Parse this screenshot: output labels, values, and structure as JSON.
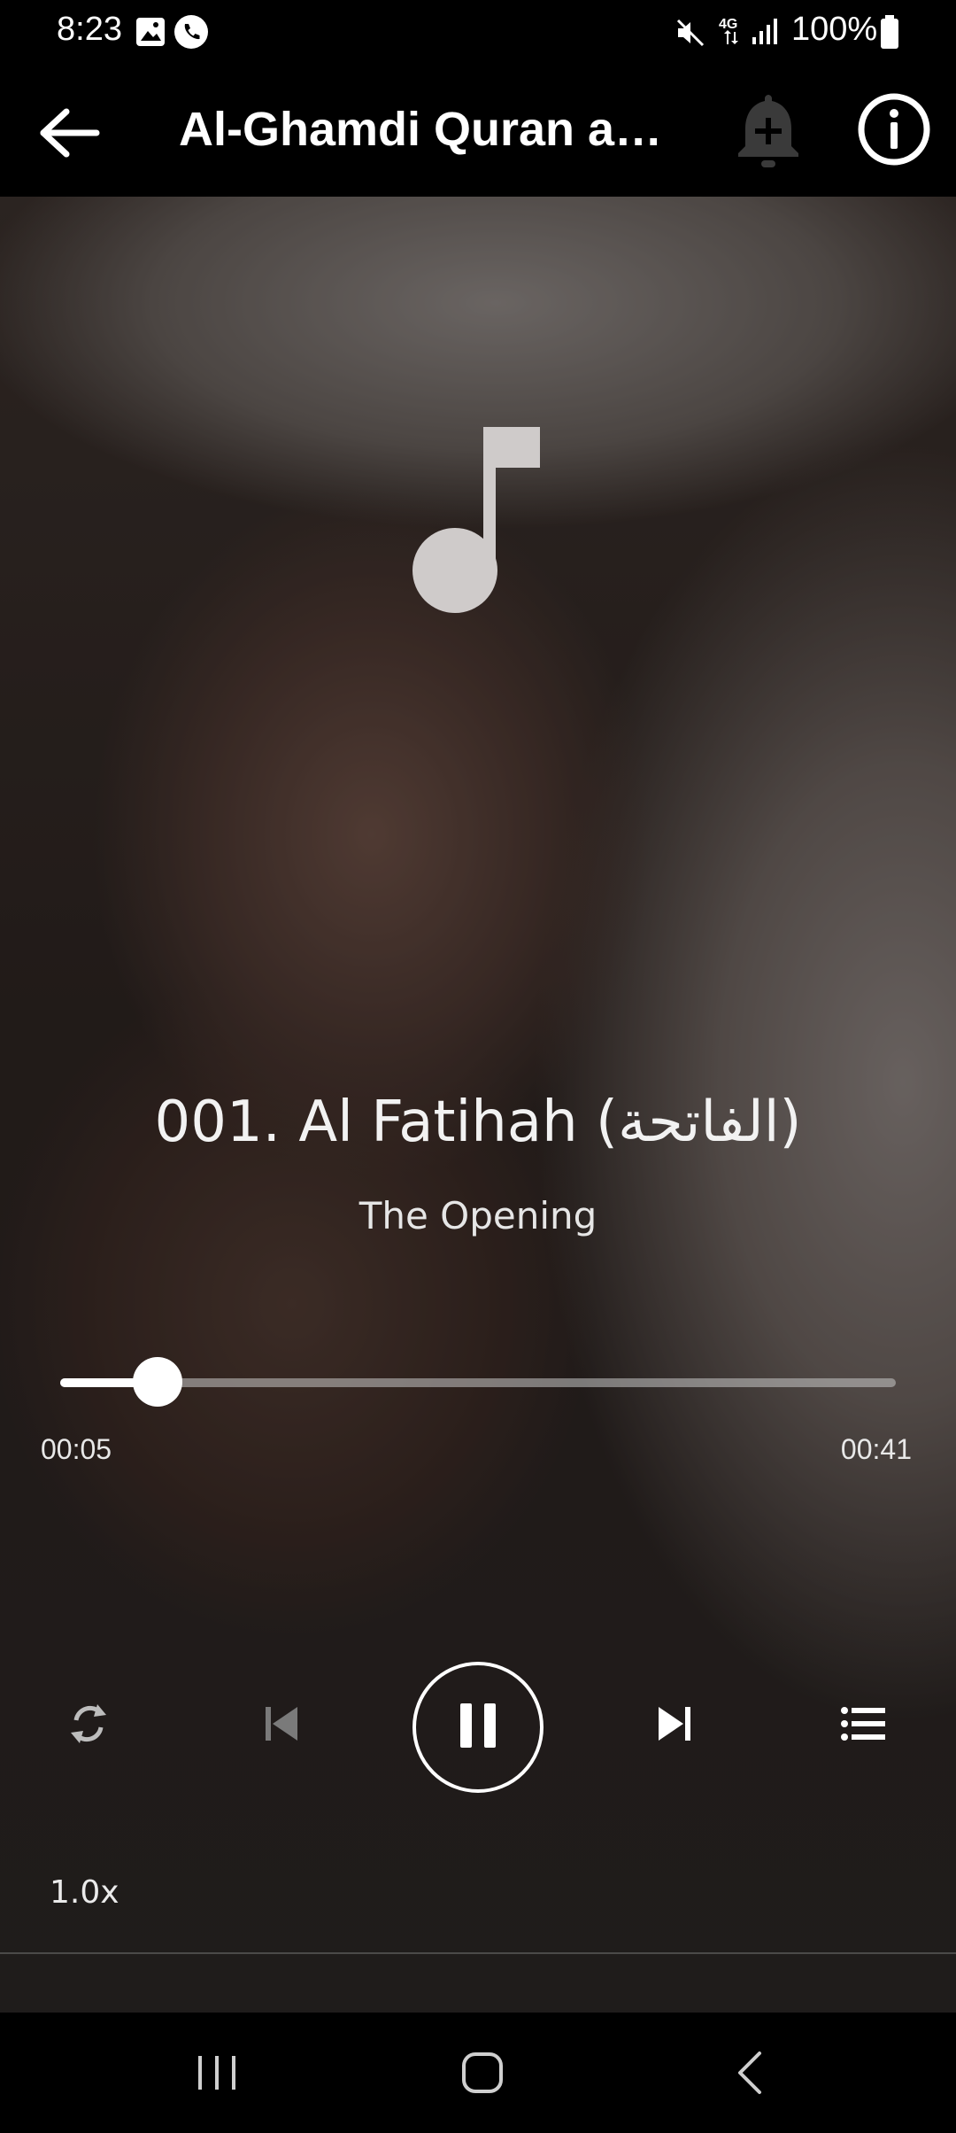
{
  "status_bar": {
    "time": "8:23",
    "battery": "100%",
    "icons": [
      "gallery-icon",
      "phone-icon",
      "mute-icon",
      "4g-icon",
      "signal-icon",
      "battery-icon"
    ]
  },
  "app_bar": {
    "title": "Al-Ghamdi Quran a…",
    "icons": [
      "back-arrow-icon",
      "bell-plus-icon",
      "info-icon"
    ]
  },
  "track": {
    "title": "001. Al Fatihah (الفاتحة)",
    "subtitle": "The Opening"
  },
  "progress": {
    "elapsed": "00:05",
    "total": "00:41",
    "fraction": 0.116
  },
  "controls": {
    "speed": "1.0x",
    "icons": [
      "repeat-icon",
      "previous-icon",
      "pause-icon",
      "next-icon",
      "playlist-icon"
    ]
  },
  "colors": {
    "accent": "#ffffff",
    "background": "#000000"
  }
}
